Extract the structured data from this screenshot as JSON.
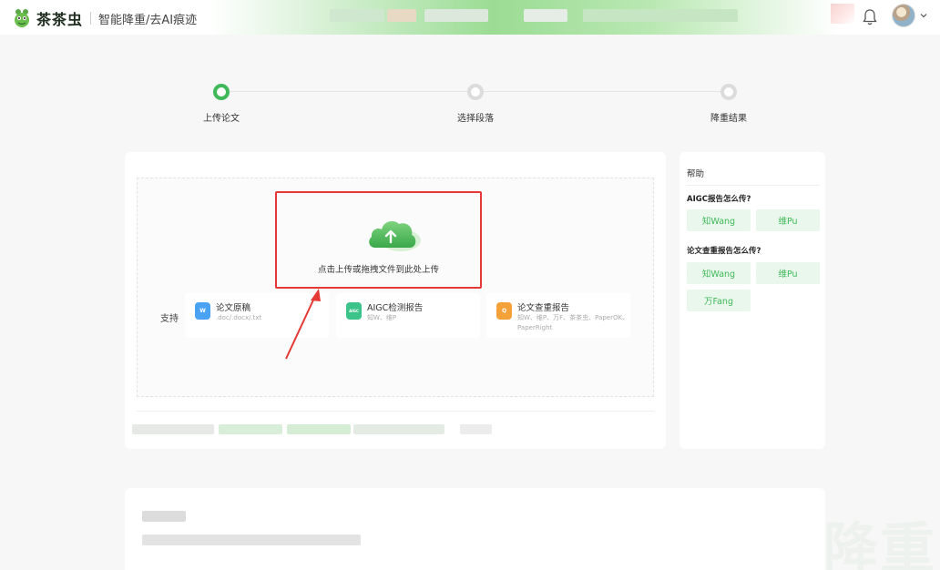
{
  "header": {
    "brand": "茶茶虫",
    "slogan": "智能降重/去AI痕迹"
  },
  "steps": [
    {
      "label": "上传论文",
      "state": "active"
    },
    {
      "label": "选择段落",
      "state": "idle"
    },
    {
      "label": "降重结果",
      "state": "idle"
    }
  ],
  "upload": {
    "hint": "点击上传或拖拽文件到此处上传",
    "support_label": "支持",
    "formats": [
      {
        "title": "论文原稿",
        "sub": ".doc/.docx/.txt",
        "icon": "W",
        "color": "#4aa3f2"
      },
      {
        "title": "AIGC检测报告",
        "sub": "知W、维P",
        "icon": "AIGC",
        "color": "#3cc38a"
      },
      {
        "title": "论文查重报告",
        "sub": "知W、维P、万F、茶茶虫、PaperOK、PaperRight",
        "icon": "Q",
        "color": "#f5a13a"
      }
    ]
  },
  "help": {
    "title": "帮助",
    "q1": "AIGC报告怎么传?",
    "q1_buttons": [
      "知Wang",
      "维Pu"
    ],
    "q2": "论文查重报告怎么传?",
    "q2_buttons": [
      "知Wang",
      "维Pu",
      "万Fang"
    ]
  },
  "colors": {
    "accent": "#3fb95a",
    "highlight": "#e53935"
  }
}
